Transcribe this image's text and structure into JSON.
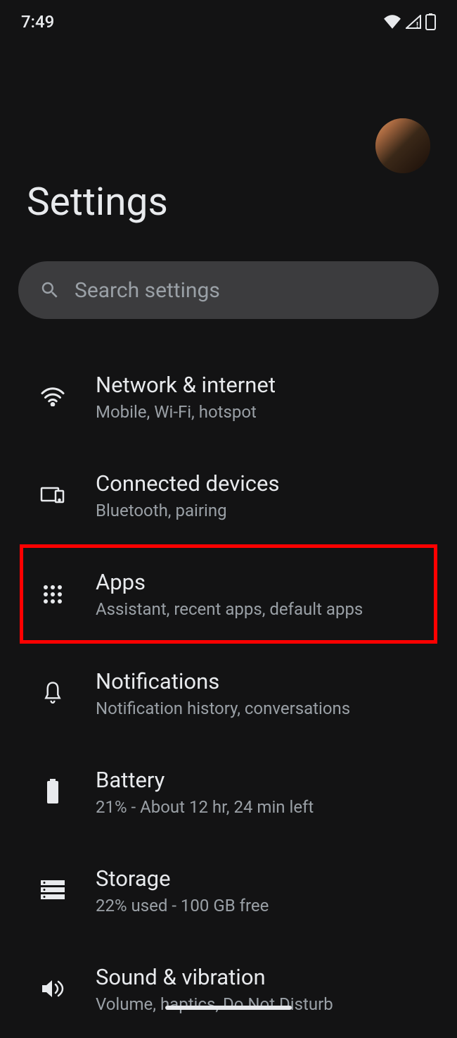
{
  "status_bar": {
    "time": "7:49"
  },
  "header": {
    "title": "Settings"
  },
  "search": {
    "placeholder": "Search settings"
  },
  "settings_items": [
    {
      "title": "Network & internet",
      "subtitle": "Mobile, Wi-Fi, hotspot",
      "icon": "wifi-icon",
      "highlighted": false
    },
    {
      "title": "Connected devices",
      "subtitle": "Bluetooth, pairing",
      "icon": "devices-icon",
      "highlighted": false
    },
    {
      "title": "Apps",
      "subtitle": "Assistant, recent apps, default apps",
      "icon": "apps-icon",
      "highlighted": true
    },
    {
      "title": "Notifications",
      "subtitle": "Notification history, conversations",
      "icon": "bell-icon",
      "highlighted": false
    },
    {
      "title": "Battery",
      "subtitle": "21% - About 12 hr, 24 min left",
      "icon": "battery-icon",
      "highlighted": false
    },
    {
      "title": "Storage",
      "subtitle": "22% used - 100 GB free",
      "icon": "storage-icon",
      "highlighted": false
    },
    {
      "title": "Sound & vibration",
      "subtitle": "Volume, haptics, Do Not Disturb",
      "icon": "sound-icon",
      "highlighted": false
    }
  ]
}
